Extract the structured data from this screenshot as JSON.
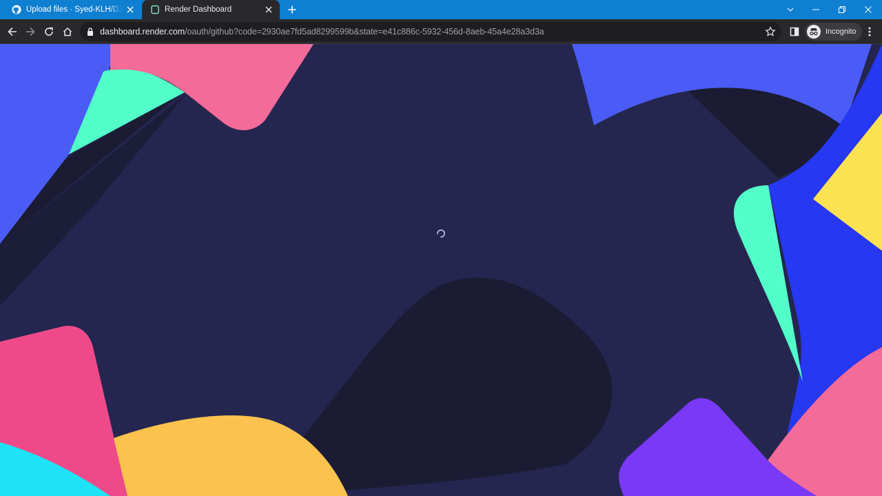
{
  "browser": {
    "tabs": [
      {
        "title": "Upload files · Syed-KLH/DJANGO",
        "favicon": "github-icon",
        "active": false
      },
      {
        "title": "Render Dashboard",
        "favicon": "render-icon",
        "active": true
      }
    ],
    "address_bar": {
      "url_host": "dashboard.render.com",
      "url_path": "/oauth/github?code=2930ae7fd5ad8299599b&state=e41c886c-5932-456d-8aeb-45a4e28a3d3a"
    },
    "profile_label": "Incognito"
  },
  "page": {
    "state": "loading",
    "spinner_icon": "loading-spinner-icon"
  },
  "colors": {
    "tab_strip": "#0f7fd1",
    "toolbar": "#29292c",
    "page_background": "#25264f",
    "shape_blue": "#4a5cf5",
    "shape_pink": "#f26b99",
    "shape_mint": "#53ffc9",
    "shape_yellow": "#fbc24e",
    "shape_cyan": "#1ee2f5",
    "shape_purple": "#7a38f7"
  }
}
